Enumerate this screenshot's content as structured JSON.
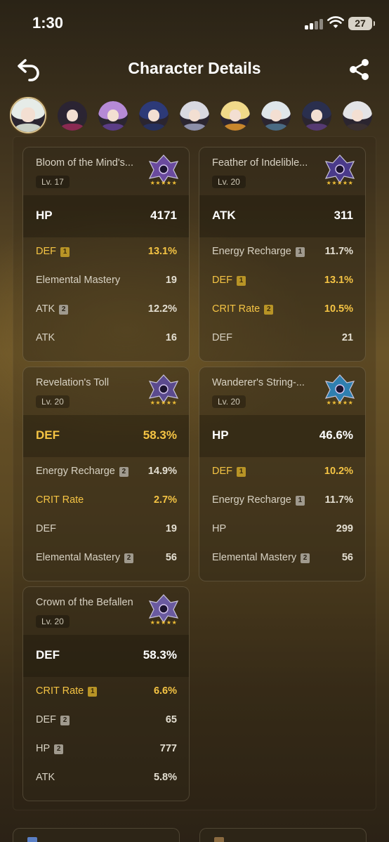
{
  "status_bar": {
    "time": "1:30",
    "battery": "27"
  },
  "header": {
    "title": "Character Details"
  },
  "colors": {
    "accent_gold": "#f5c444",
    "star": "#f0bf36"
  },
  "characters": [
    {
      "name_icon": "character-avatar-1",
      "hair": "#e6ece8",
      "body": "#c9d0c6",
      "selected": true
    },
    {
      "name_icon": "character-avatar-2",
      "hair": "#2b2433",
      "body": "#8a2a52",
      "selected": false
    },
    {
      "name_icon": "character-avatar-3",
      "hair": "#b68ad6",
      "body": "#5b3d86",
      "selected": false
    },
    {
      "name_icon": "character-avatar-4",
      "hair": "#2d3a78",
      "body": "#27305d",
      "selected": false
    },
    {
      "name_icon": "character-avatar-5",
      "hair": "#d8d8e0",
      "body": "#8c8ea8",
      "selected": false
    },
    {
      "name_icon": "character-avatar-6",
      "hair": "#f0d98a",
      "body": "#c8862c",
      "selected": false
    },
    {
      "name_icon": "character-avatar-7",
      "hair": "#dfe6ea",
      "body": "#4a6a82",
      "selected": false
    },
    {
      "name_icon": "character-avatar-8",
      "hair": "#2a2f4e",
      "body": "#563a72",
      "selected": false
    },
    {
      "name_icon": "character-avatar-9",
      "hair": "#e4e4e6",
      "body": "#3a3030",
      "selected": false
    }
  ],
  "artifacts": [
    {
      "name": "Bloom of the Mind's...",
      "level": "Lv. 17",
      "stars": "★★★★★",
      "art_color": "#6a4a9e",
      "main": {
        "name": "HP",
        "value": "4171",
        "gold": false
      },
      "subs": [
        {
          "name": "DEF",
          "roll": "1",
          "value": "13.1%",
          "gold": true
        },
        {
          "name": "Elemental Mastery",
          "roll": "",
          "value": "19",
          "gold": false
        },
        {
          "name": "ATK",
          "roll": "2",
          "value": "12.2%",
          "gold": false
        },
        {
          "name": "ATK",
          "roll": "",
          "value": "16",
          "gold": false
        }
      ]
    },
    {
      "name": "Feather of Indelible...",
      "level": "Lv. 20",
      "stars": "★★★★★",
      "art_color": "#4a3a8a",
      "main": {
        "name": "ATK",
        "value": "311",
        "gold": false
      },
      "subs": [
        {
          "name": "Energy Recharge",
          "roll": "1",
          "value": "11.7%",
          "gold": false
        },
        {
          "name": "DEF",
          "roll": "1",
          "value": "13.1%",
          "gold": true
        },
        {
          "name": "CRIT Rate",
          "roll": "2",
          "value": "10.5%",
          "gold": true
        },
        {
          "name": "DEF",
          "roll": "",
          "value": "21",
          "gold": false
        }
      ]
    },
    {
      "name": "Revelation's Toll",
      "level": "Lv. 20",
      "stars": "★★★★★",
      "art_color": "#5b4a8e",
      "main": {
        "name": "DEF",
        "value": "58.3%",
        "gold": true
      },
      "subs": [
        {
          "name": "Energy Recharge",
          "roll": "2",
          "value": "14.9%",
          "gold": false
        },
        {
          "name": "CRIT Rate",
          "roll": "",
          "value": "2.7%",
          "gold": true
        },
        {
          "name": "DEF",
          "roll": "",
          "value": "19",
          "gold": false
        },
        {
          "name": "Elemental Mastery",
          "roll": "2",
          "value": "56",
          "gold": false
        }
      ]
    },
    {
      "name": "Wanderer's String-...",
      "level": "Lv. 20",
      "stars": "★★★★★",
      "art_color": "#2f7fb0",
      "main": {
        "name": "HP",
        "value": "46.6%",
        "gold": false
      },
      "subs": [
        {
          "name": "DEF",
          "roll": "1",
          "value": "10.2%",
          "gold": true
        },
        {
          "name": "Energy Recharge",
          "roll": "1",
          "value": "11.7%",
          "gold": false
        },
        {
          "name": "HP",
          "roll": "",
          "value": "299",
          "gold": false
        },
        {
          "name": "Elemental Mastery",
          "roll": "2",
          "value": "56",
          "gold": false
        }
      ]
    },
    {
      "name": "Crown of the Befallen",
      "level": "Lv. 20",
      "stars": "★★★★★",
      "art_color": "#6a5aa0",
      "main": {
        "name": "DEF",
        "value": "58.3%",
        "gold": false
      },
      "subs": [
        {
          "name": "CRIT Rate",
          "roll": "1",
          "value": "6.6%",
          "gold": true
        },
        {
          "name": "DEF",
          "roll": "2",
          "value": "65",
          "gold": false
        },
        {
          "name": "HP",
          "roll": "2",
          "value": "777",
          "gold": false
        },
        {
          "name": "ATK",
          "roll": "",
          "value": "5.8%",
          "gold": false
        }
      ]
    }
  ]
}
